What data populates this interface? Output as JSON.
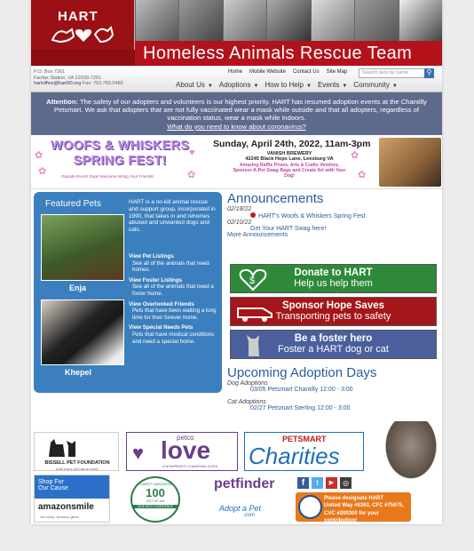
{
  "header": {
    "logo_text": "HART",
    "title": "Homeless Animals Rescue Team"
  },
  "address": {
    "line1": "P.O. Box 7261",
    "line2": "Fairfax Station, VA 22039-7261",
    "email": "hartoffice@hart90.org",
    "fax": "Fax: 703.783.0489"
  },
  "top_links": [
    "Home",
    "Mobile Website",
    "Contact Us",
    "Site Map"
  ],
  "search": {
    "placeholder": "Search pets by name"
  },
  "nav": [
    "About Us",
    "Adoptions",
    "How to Help",
    "Events",
    "Community"
  ],
  "alert": {
    "lead": "Attention:",
    "text": "The safety of our adopters and volunteers is our highest priority. HART has resumed adoption events at the Chantilly Petsmart. We ask that adopters that are not fully vaccinated wear a mask while outside and that all adopters, regardless of vaccination status, wear a mask while indoors.",
    "link": "What do you need to know about coronavirus?"
  },
  "fest": {
    "title1": "WOOFS & WHISKERS",
    "title2": "SPRING FEST!",
    "sub": "Outside Event! Dogs Welcome! Bring Your Friends!",
    "date": "Sunday, April 24th, 2022, 11am-3pm",
    "venue": "VANISH BREWERY",
    "address": "42245 Black Hops Lane, Leesburg VA",
    "promo1": "Amazing Raffle Prizes, Arts & Crafts Vendors,",
    "promo2": "Sponsor-A-Pet Swag Bags and Create Art with Your Dog!"
  },
  "featured": {
    "heading": "Featured Pets",
    "pets": [
      "Enja",
      "Khepel"
    ],
    "about": "HART is a no-kill animal rescue and support group, incorporated in 1990, that takes in and rehomes abused and unwanted dogs and cats.",
    "links": [
      {
        "title": "View Pet Listings",
        "desc": "See all of the animals that need homes."
      },
      {
        "title": "View Foster Listings",
        "desc": "See all of the animals that need a foster home."
      },
      {
        "title": "View Overlooked Friends",
        "desc": "Pets that have been waiting a long time for their forever home."
      },
      {
        "title": "View Special Needs Pets",
        "desc": "Pets that have medical conditions and need a special home."
      }
    ]
  },
  "announcements": {
    "heading": "Announcements",
    "items": [
      {
        "date": "02/18/22",
        "text": "HART's Woofs & Whiskers Spring Fest"
      },
      {
        "date": "02/10/22",
        "text": "Get Your HART Swag here!"
      }
    ],
    "more": "More Announcements"
  },
  "cta": [
    {
      "l1": "Donate to HART",
      "l2": "Help us help them",
      "color": "#2e8a3a"
    },
    {
      "l1": "Sponsor Hope Saves",
      "l2": "Transporting pets to safety",
      "color": "#a4161a"
    },
    {
      "l1": "Be a foster hero",
      "l2": "Foster a HART dog or cat",
      "color": "#4a5f9c"
    }
  ],
  "adoption_days": {
    "heading": "Upcoming Adoption Days",
    "groups": [
      {
        "label": "Dog Adoptions",
        "entry": "03/05 Petsmart Chantilly 12:00 - 3:00"
      },
      {
        "label": "Cat Adoptions",
        "entry": "02/27 Petsmart Sterling 12:00 - 3:00"
      }
    ]
  },
  "sponsors": {
    "bissell": "BISSELL PET FOUNDATION",
    "bissell_tag": "Until every pet has a home.",
    "petco_top": "petco",
    "petco_main": "love",
    "petco_tag": "A NONPROFIT CHANGING LIVES",
    "pets_top": "PETSMART",
    "pets_main": "Charities"
  },
  "footer": {
    "shop1": "Shop For",
    "shop2": "Our Cause",
    "amazon": "amazonsmile",
    "amazon_tag": "You shop. Amazon gives.",
    "charity_top": "CHARITY NAVIGATOR",
    "charity_score": "100",
    "charity_sub": "OUT OF 100",
    "charity_bot": "GIVE WITH CONFIDENCE",
    "petfinder": "petfinder",
    "adoptapet1": "Adopt a Pet",
    "adoptapet2": ".com",
    "designate1": "Please designate HART",
    "designate2": "United Way #8363, CFC #75675,",
    "designate3": "CVC #200300 for your contribution!"
  }
}
